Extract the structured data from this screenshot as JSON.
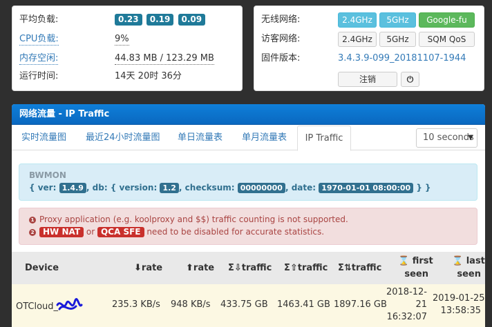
{
  "stats": {
    "load_label": "平均负载:",
    "load_values": [
      "0.23",
      "0.19",
      "0.09"
    ],
    "cpu_label": "CPU负载:",
    "cpu_value": "9%",
    "mem_label": "内存空闲:",
    "mem_value": "44.83 MB / 123.29 MB",
    "uptime_label": "运行时间:",
    "uptime_value": "14天 20时 36分"
  },
  "network": {
    "wireless_label": "无线网络:",
    "wireless_buttons": [
      "2.4GHz",
      "5GHz",
      "Google-fu"
    ],
    "guest_label": "访客网络:",
    "guest_buttons": [
      "2.4GHz",
      "5GHz",
      "SQM QoS"
    ],
    "firmware_label": "固件版本:",
    "firmware_value": "3.4.3.9-099_20181107-1944",
    "logout_label": "注销",
    "power_icon": "⏻"
  },
  "traffic": {
    "header": "网络流量 - IP Traffic",
    "tabs": [
      "实时流量图",
      "最近24小时流量图",
      "单日流量表",
      "单月流量表",
      "IP Traffic"
    ],
    "interval_value": "10 seconds",
    "bwmon": {
      "title": "BWMON",
      "line": [
        "{ ver: ",
        "1.4.9",
        ", db: { version: ",
        "1.2",
        ", checksum: ",
        "00000000",
        ", date: ",
        "1970-01-01 08:00:00",
        " } }"
      ]
    },
    "warnings": {
      "line1_num": "1",
      "line1_text": "Proxy application (e.g. koolproxy and $$) traffic counting is not supported.",
      "line2_num": "2",
      "hw_nat": "HW NAT",
      "or_text": "or",
      "qca_sfe": "QCA SFE",
      "line2_text": "need to be disabled for accurate statistics."
    },
    "table": {
      "headers": {
        "device": "Device",
        "rate_down": "rate",
        "rate_up": "rate",
        "traffic_down": "traffic",
        "traffic_up": "traffic",
        "traffic_total": "traffic",
        "first_seen_1": "first",
        "first_seen_2": "seen",
        "last_seen_1": "last",
        "last_seen_2": "seen"
      },
      "row": {
        "device": "OTCloud_",
        "rate_down": "235.3 KB/s",
        "rate_up": "948 KB/s",
        "traffic_down": "433.75 GB",
        "traffic_up": "1463.41 GB",
        "traffic_total": "1897.16 GB",
        "first_seen_date_1": "2018-12-",
        "first_seen_date_2": "21",
        "first_seen_time": "16:32:07",
        "last_seen_date": "2019-01-25",
        "last_seen_time": "13:58:35"
      }
    }
  },
  "colors": {
    "header_blue": "#0f7fd9",
    "badge_blue": "#1f7a99",
    "info_button": "#5bc0de",
    "success_button": "#5cb85c",
    "alert_info_bg": "#d9edf7",
    "alert_danger_bg": "#f2dede",
    "row_highlight": "#fcf8e3"
  }
}
